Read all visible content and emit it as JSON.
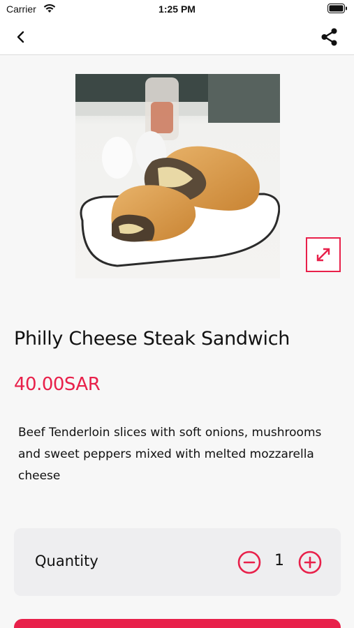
{
  "status_bar": {
    "carrier": "Carrier",
    "time": "1:25 PM"
  },
  "nav": {
    "back_icon": "chevron-left-icon",
    "share_icon": "share-icon"
  },
  "product": {
    "image_icon": "sandwich-photo",
    "expand_icon": "expand-icon",
    "title": "Philly Cheese Steak Sandwich",
    "price": "40.00SAR",
    "description": "Beef Tenderloin slices with soft onions, mushrooms and sweet peppers mixed with melted mozzarella cheese"
  },
  "quantity": {
    "label": "Quantity",
    "value": "1",
    "minus_icon": "minus-circle-icon",
    "plus_icon": "plus-circle-icon"
  },
  "colors": {
    "accent": "#e8204a",
    "background": "#f7f7f7",
    "card": "#eeeef0"
  }
}
